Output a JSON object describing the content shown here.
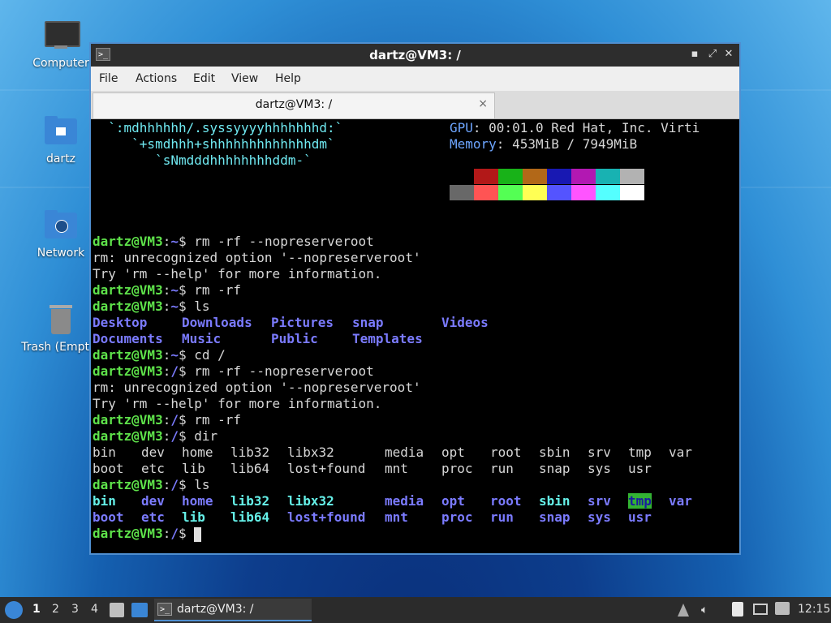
{
  "desktop": {
    "icons": [
      {
        "label": "Computer"
      },
      {
        "label": "dartz"
      },
      {
        "label": "Network"
      },
      {
        "label": "Trash (Empty)"
      }
    ]
  },
  "window": {
    "title": "dartz@VM3: /",
    "menu": [
      "File",
      "Actions",
      "Edit",
      "View",
      "Help"
    ],
    "tab_title": "dartz@VM3: /",
    "tab_close": "×",
    "controls": {
      "minimize": "▪",
      "maximize": "⤢",
      "close": "✕"
    }
  },
  "terminal": {
    "ascii": [
      "  `:mdhhhhhh/.syssyyyyhhhhhhhd:`",
      "     `+smdhhh+shhhhhhhhhhhhhdm`",
      "        `sNmdddhhhhhhhhddm-`"
    ],
    "sysinfo": [
      {
        "label": "GPU",
        "value": ": 00:01.0 Red Hat, Inc. Virti"
      },
      {
        "label": "Memory",
        "value": ": 453MiB / 7949MiB"
      }
    ],
    "prompt_user": "dartz@VM3",
    "lines": {
      "l1_cmd": "rm -rf --nopreserveroot",
      "l2": "rm: unrecognized option '--nopreserveroot'",
      "l3": "Try 'rm --help' for more information.",
      "l4_cmd": "rm -rf",
      "l5_cmd": "ls",
      "ls_home_row1": [
        "Desktop",
        "Downloads",
        "Pictures",
        "snap",
        "Videos"
      ],
      "ls_home_row2": [
        "Documents",
        "Music",
        "Public",
        "Templates"
      ],
      "l8_cmd": "cd /",
      "l9_cmd": "rm -rf --nopreserveroot",
      "l10": "rm: unrecognized option '--nopreserveroot'",
      "l11": "Try 'rm --help' for more information.",
      "l12_cmd": "rm -rf",
      "l13_cmd": "dir",
      "dir_row1": [
        "bin",
        "dev",
        "home",
        "lib32",
        "libx32",
        "media",
        "opt",
        "root",
        "sbin",
        "srv",
        "tmp",
        "var"
      ],
      "dir_row2": [
        "boot",
        "etc",
        "lib",
        "lib64",
        "lost+found",
        "mnt",
        "proc",
        "run",
        "snap",
        "sys",
        "usr"
      ],
      "l16_cmd": "ls",
      "ls_root_row1": [
        "bin",
        "dev",
        "home",
        "lib32",
        "libx32",
        "media",
        "opt",
        "root",
        "sbin",
        "srv",
        "tmp",
        "var"
      ],
      "ls_root_row2": [
        "boot",
        "etc",
        "lib",
        "lib64",
        "lost+found",
        "mnt",
        "proc",
        "run",
        "snap",
        "sys",
        "usr"
      ]
    },
    "home_dir": "~",
    "root_dir": "/",
    "prompt_suffix": "$ "
  },
  "taskbar": {
    "workspaces": [
      "1",
      "2",
      "3",
      "4"
    ],
    "task_label": "dartz@VM3: /",
    "clock": "12:15"
  },
  "colors": {
    "palette_top": [
      "#000000",
      "#b21818",
      "#18b218",
      "#b26818",
      "#1818b2",
      "#b218b2",
      "#18b2b2",
      "#b2b2b2"
    ],
    "palette_bottom": [
      "#686868",
      "#ff5454",
      "#54ff54",
      "#ffff54",
      "#5454ff",
      "#ff54ff",
      "#54ffff",
      "#ffffff"
    ]
  }
}
